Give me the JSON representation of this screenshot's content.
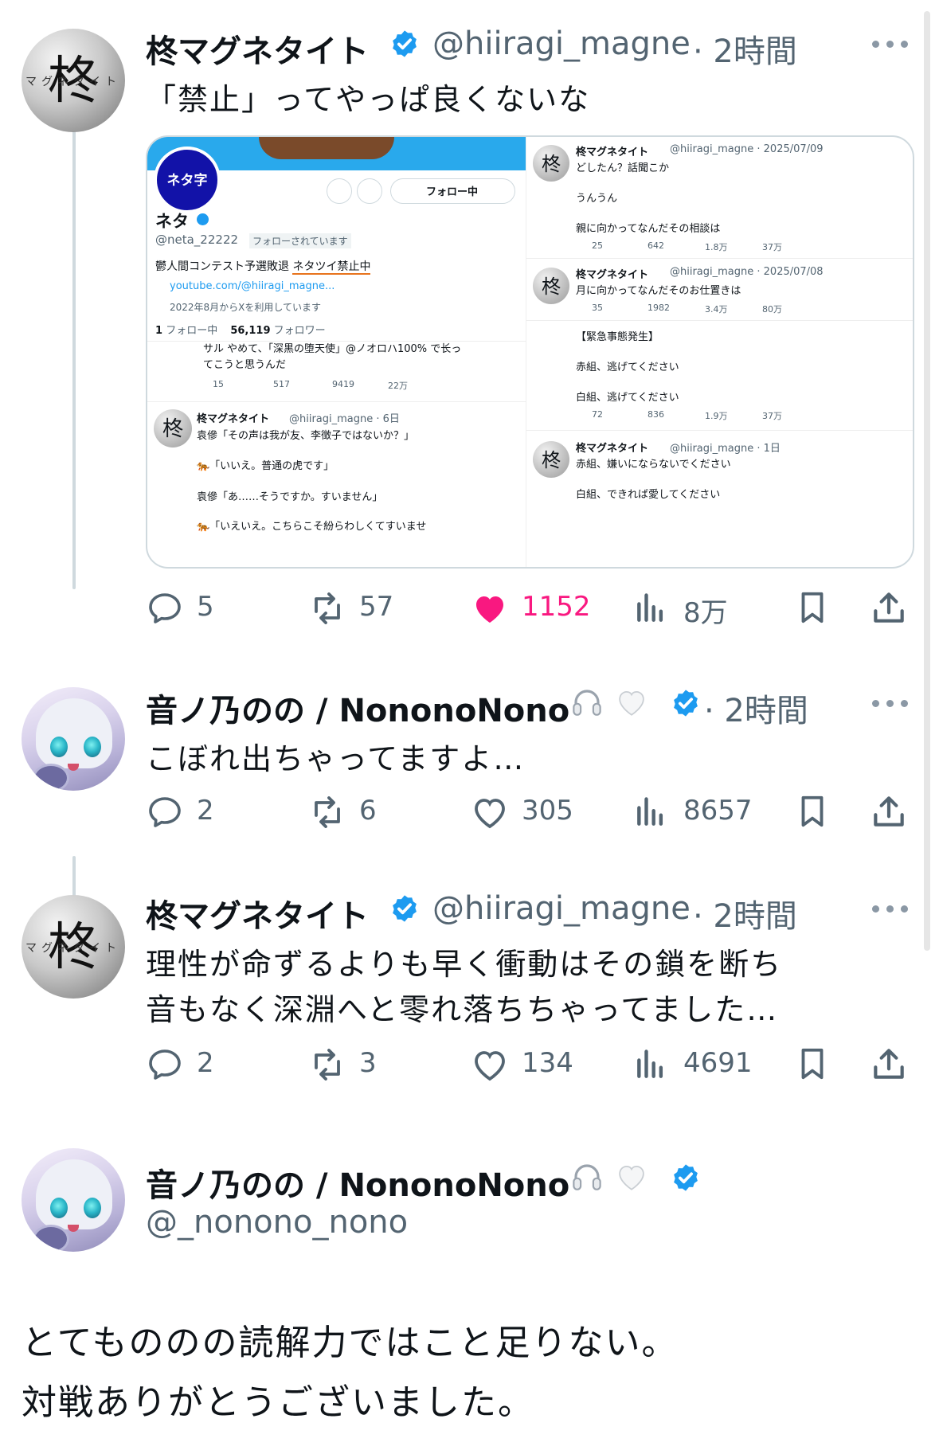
{
  "posts": [
    {
      "name": "柊マグネタイト",
      "handle": "@hiiragi_magne",
      "time": "· 2時間",
      "text": "「禁止」ってやっぱ良くないな",
      "actions": {
        "replies": "5",
        "reposts": "57",
        "likes": "1152",
        "views": "8万"
      },
      "liked": true,
      "avatar": {
        "kanji": "柊",
        "ring_text": "マグネタイト"
      }
    },
    {
      "name": "音ノ乃のの / NononoNono",
      "time": "· 2時間",
      "text": "こぼれ出ちゃってますよ…",
      "actions": {
        "replies": "2",
        "reposts": "6",
        "likes": "305",
        "views": "8657"
      },
      "liked": false,
      "name_emojis": [
        "headphones-icon",
        "white-heart-icon"
      ]
    },
    {
      "name": "柊マグネタイト",
      "handle": "@hiiragi_magne",
      "time": "· 2時間",
      "lines": [
        "理性が命ずるよりも早く衝動はその鎖を断ち",
        "音もなく深淵へと零れ落ちちゃってました…"
      ],
      "actions": {
        "replies": "2",
        "reposts": "3",
        "likes": "134",
        "views": "4691"
      },
      "liked": false,
      "avatar": {
        "kanji": "柊",
        "ring_text": "マグネタイト"
      }
    }
  ],
  "reply_box": {
    "name": "音ノ乃のの / NononoNono",
    "handle": "@_nonono_nono",
    "lines": [
      "とてもののの読解力ではこと足りない。",
      "対戦ありがとうございました。"
    ]
  },
  "embedded": {
    "profile": {
      "banner_logo": "ネタ字",
      "follow_button": "フォロー中",
      "name": "ネタ",
      "handle": "@neta_22222",
      "follows_you": "フォローされています",
      "bio_prefix": "鬱人間コンテスト予選敗退 ",
      "bio_highlight": "ネタツイ禁止中",
      "link": "youtube.com/@hiiragi_magne...",
      "joined": "2022年8月からXを利用しています",
      "following_count": "1",
      "following_label": "フォロー中",
      "followers_count": "56,119",
      "followers_label": "フォロワー",
      "partial_line1": "サル やめて、「深黒の堕天使」@ノオロハ100% で长っ",
      "partial_line2": "てこうと思うんだ",
      "partial_actions": {
        "replies": "15",
        "reposts": "517",
        "likes": "9419",
        "views": "22万"
      }
    },
    "left_post": {
      "name": "柊マグネタイト",
      "handle": "@hiiragi_magne · 6日",
      "lines": [
        "袁傪「その声は我が友、李徴子ではないか？」",
        "🐅「いいえ。普通の虎です」",
        "袁傪「あ……そうですか。すいません」",
        "🐅「いえいえ。こちらこそ紛らわしくてすいませ"
      ]
    },
    "right_posts": [
      {
        "name": "柊マグネタイト",
        "handle": "@hiiragi_magne · 2025/07/09",
        "lines": [
          "どしたん？話聞こか",
          "うんうん",
          "親に向かってなんだその相談は"
        ],
        "actions": {
          "replies": "25",
          "reposts": "642",
          "likes": "1.8万",
          "views": "37万"
        }
      },
      {
        "name": "柊マグネタイト",
        "handle": "@hiiragi_magne · 2025/07/08",
        "lines": [
          "月に向かってなんだそのお仕置きは"
        ],
        "actions": {
          "replies": "35",
          "reposts": "1982",
          "likes": "3.4万",
          "views": "80万"
        }
      },
      {
        "lines": [
          "【緊急事態発生】",
          "赤組、逃げてください",
          "白組、逃げてください"
        ],
        "actions": {
          "replies": "72",
          "reposts": "836",
          "likes": "1.9万",
          "views": "37万"
        }
      },
      {
        "name": "柊マグネタイト",
        "handle": "@hiiragi_magne · 1日",
        "lines": [
          "赤組、嫌いにならないでください",
          "白組、できれば愛してください"
        ]
      }
    ],
    "avatar_kanji": "柊"
  },
  "colors": {
    "like_pink": "#f91880",
    "verified_blue": "#1d9bf0",
    "gray_text": "#536471"
  }
}
